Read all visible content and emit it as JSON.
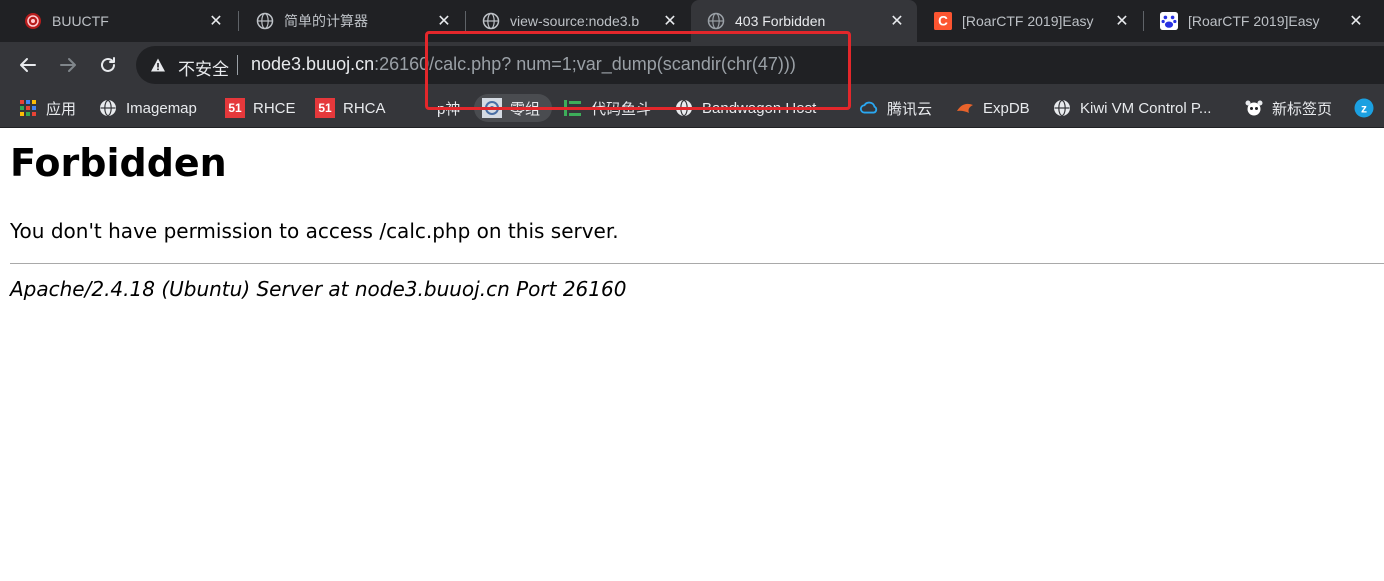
{
  "tabs": [
    {
      "title": "BUUCTF",
      "icon": "buuctf-logo-icon",
      "active": false
    },
    {
      "title": "简单的计算器",
      "icon": "globe-icon",
      "active": false
    },
    {
      "title": "view-source:node3.b",
      "icon": "globe-icon",
      "active": false
    },
    {
      "title": "403 Forbidden",
      "icon": "globe-icon",
      "active": true
    },
    {
      "title": "[RoarCTF 2019]Easy",
      "icon": "csdn-icon",
      "active": false
    },
    {
      "title": "[RoarCTF 2019]Easy",
      "icon": "baidu-paw-icon",
      "active": false
    }
  ],
  "toolbar": {
    "back": "back-arrow-icon",
    "forward": "forward-arrow-icon",
    "reload": "reload-icon"
  },
  "omnibox": {
    "security_label": "不安全",
    "url_host": "node3.buuoj.cn",
    "url_rest": ":26160/calc.php? num=1;var_dump(scandir(chr(47)))"
  },
  "bookmarks": [
    {
      "label": "应用",
      "icon": "apps-grid-icon"
    },
    {
      "label": "Imagemap",
      "icon": "globe-icon"
    },
    {
      "label": "RHCE",
      "icon": "badge-51-icon"
    },
    {
      "label": "RHCA",
      "icon": "badge-51-icon"
    },
    {
      "label": "p神",
      "icon": ""
    },
    {
      "label": "零组",
      "icon": "zero-group-icon"
    },
    {
      "label": "代码鱼斗",
      "icon": "code-fish-icon"
    },
    {
      "label": "Bandwagon Host",
      "icon": "globe-icon"
    },
    {
      "label": "腾讯云",
      "icon": "tencent-cloud-icon"
    },
    {
      "label": "ExpDB",
      "icon": "expdb-icon"
    },
    {
      "label": "Kiwi VM Control P...",
      "icon": "globe-icon"
    },
    {
      "label": "新标签页",
      "icon": "panda-icon"
    },
    {
      "label": "",
      "icon": "zhihu-icon"
    }
  ],
  "badge_text": "51",
  "page": {
    "heading": "Forbidden",
    "message": "You don't have permission to access /calc.php on this server.",
    "server_signature": "Apache/2.4.18 (Ubuntu) Server at node3.buuoj.cn Port 26160"
  },
  "colors": {
    "tabstrip": "#202124",
    "toolbar": "#35363a",
    "highlight": "#e3272b",
    "csdn": "#fc5531",
    "baidu": "#2932e1"
  }
}
